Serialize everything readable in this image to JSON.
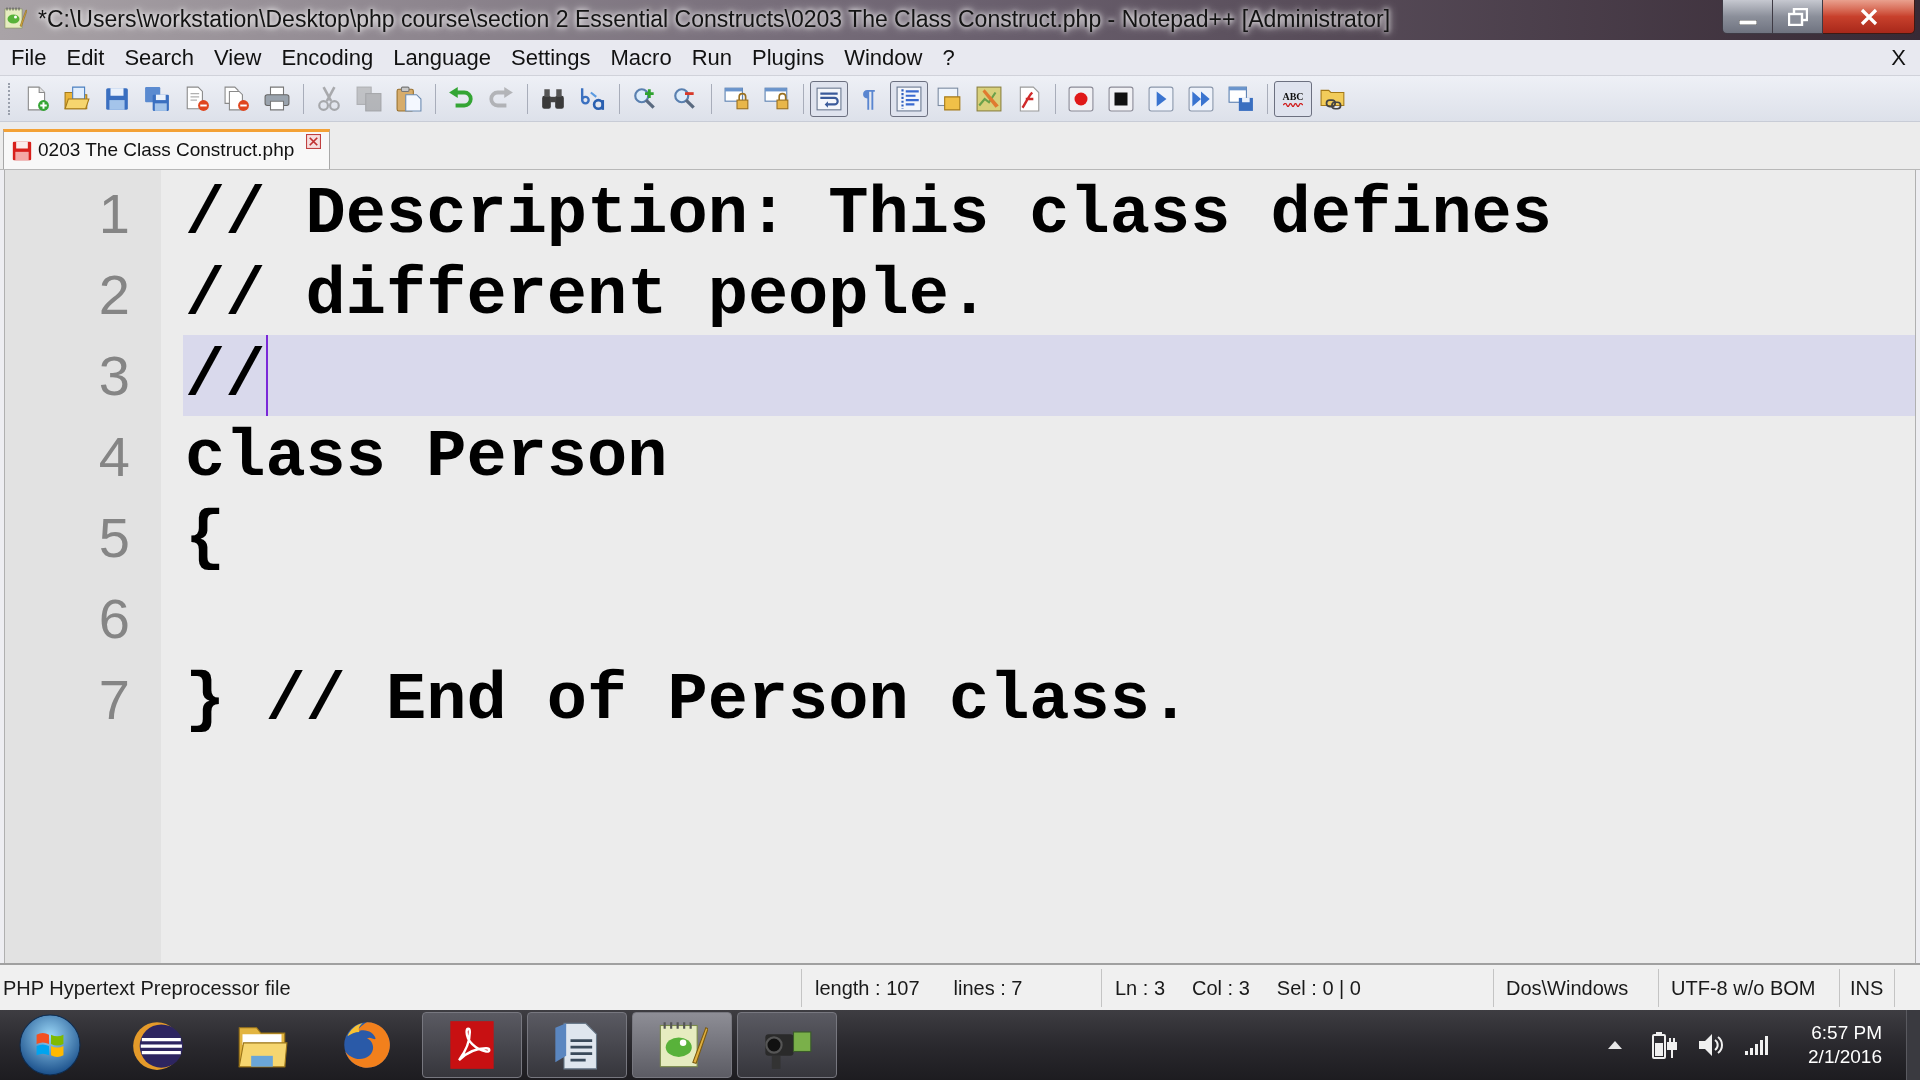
{
  "window": {
    "title": "*C:\\Users\\workstation\\Desktop\\php course\\section 2 Essential Constructs\\0203 The Class Construct.php - Notepad++ [Administrator]"
  },
  "menu_bar": {
    "items": [
      "File",
      "Edit",
      "Search",
      "View",
      "Encoding",
      "Language",
      "Settings",
      "Macro",
      "Run",
      "Plugins",
      "Window",
      "?"
    ],
    "close": "X"
  },
  "toolbar": {
    "groups": [
      {
        "buttons": [
          {
            "kind": "new",
            "pressed": false,
            "disabled": false
          },
          {
            "kind": "open",
            "pressed": false,
            "disabled": false
          },
          {
            "kind": "save",
            "pressed": false,
            "disabled": false
          },
          {
            "kind": "save-all",
            "pressed": false,
            "disabled": false
          },
          {
            "kind": "close",
            "pressed": false,
            "disabled": false
          },
          {
            "kind": "close-all",
            "pressed": false,
            "disabled": false
          },
          {
            "kind": "print",
            "pressed": false,
            "disabled": false
          }
        ]
      },
      {
        "buttons": [
          {
            "kind": "cut",
            "pressed": false,
            "disabled": true
          },
          {
            "kind": "copy",
            "pressed": false,
            "disabled": true
          },
          {
            "kind": "paste",
            "pressed": false,
            "disabled": false
          }
        ]
      },
      {
        "buttons": [
          {
            "kind": "undo",
            "pressed": false,
            "disabled": false
          },
          {
            "kind": "redo",
            "pressed": false,
            "disabled": true
          }
        ]
      },
      {
        "buttons": [
          {
            "kind": "find",
            "pressed": false,
            "disabled": false
          },
          {
            "kind": "replace",
            "pressed": false,
            "disabled": false
          }
        ]
      },
      {
        "buttons": [
          {
            "kind": "zoom-in",
            "pressed": false,
            "disabled": false
          },
          {
            "kind": "zoom-out",
            "pressed": false,
            "disabled": false
          }
        ]
      },
      {
        "buttons": [
          {
            "kind": "sync-vertical",
            "pressed": false,
            "disabled": false
          },
          {
            "kind": "sync-horizontal",
            "pressed": false,
            "disabled": false
          }
        ]
      },
      {
        "buttons": [
          {
            "kind": "wrap",
            "pressed": true,
            "disabled": false
          },
          {
            "kind": "pilcrow",
            "label": "¶",
            "pressed": false,
            "disabled": false
          },
          {
            "kind": "indent-guide",
            "pressed": true,
            "disabled": false
          },
          {
            "kind": "doc-map",
            "pressed": false,
            "disabled": false
          },
          {
            "kind": "map-pencil",
            "pressed": false,
            "disabled": false
          },
          {
            "kind": "function-list",
            "pressed": false,
            "disabled": false
          }
        ]
      },
      {
        "buttons": [
          {
            "kind": "record",
            "pressed": false,
            "disabled": false
          },
          {
            "kind": "stop",
            "pressed": false,
            "disabled": false
          },
          {
            "kind": "play",
            "pressed": false,
            "disabled": false
          },
          {
            "kind": "play-multiple",
            "pressed": false,
            "disabled": false
          },
          {
            "kind": "save-macro",
            "pressed": false,
            "disabled": false
          }
        ]
      },
      {
        "buttons": [
          {
            "kind": "spellcheck",
            "label": "ABC",
            "pressed": true,
            "disabled": false
          },
          {
            "kind": "folder-link",
            "pressed": false,
            "disabled": false
          }
        ]
      }
    ]
  },
  "tabs": [
    {
      "label": "0203 The Class Construct.php",
      "selected": true,
      "modified": true
    }
  ],
  "editor": {
    "lines": [
      {
        "number": "1",
        "text": "// Description: This class defines",
        "current": false
      },
      {
        "number": "2",
        "text": "// different people.",
        "current": false
      },
      {
        "number": "3",
        "text": "//",
        "current": true
      },
      {
        "number": "4",
        "text": "class Person",
        "current": false
      },
      {
        "number": "5",
        "text": "{",
        "current": false
      },
      {
        "number": "6",
        "current": false
      },
      {
        "number": "7",
        "text": "} // End of Person class.",
        "current": false
      }
    ]
  },
  "status_bar": {
    "sections": [
      {
        "items": [
          "PHP Hypertext Preprocessor file"
        ]
      },
      {
        "items": [
          "length : 107",
          "lines : 7"
        ]
      },
      {
        "items": [
          "Ln : 3",
          "Col : 3",
          "Sel : 0 | 0"
        ]
      },
      {
        "items": [
          "Dos\\Windows"
        ]
      },
      {
        "items": [
          "UTF-8 w/o BOM"
        ]
      },
      {
        "items": [
          "INS"
        ]
      }
    ]
  },
  "taskbar": {
    "apps": [
      {
        "kind": "eclipse",
        "running": false,
        "selected": false
      },
      {
        "kind": "folder",
        "running": false,
        "selected": false
      },
      {
        "kind": "browser",
        "running": false,
        "selected": false
      },
      {
        "kind": "pdf",
        "running": true,
        "selected": false
      },
      {
        "kind": "writer",
        "running": true,
        "selected": false
      },
      {
        "kind": "notepad",
        "running": true,
        "selected": true
      },
      {
        "kind": "camcorder",
        "running": true,
        "selected": false
      }
    ],
    "clock": {
      "time": "6:57 PM",
      "date": "2/1/2016"
    }
  }
}
